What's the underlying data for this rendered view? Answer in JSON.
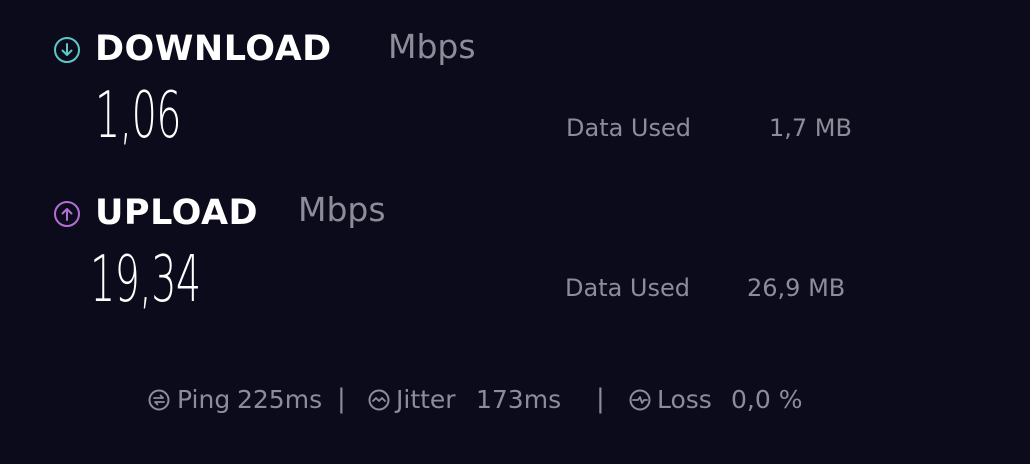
{
  "colors": {
    "background": "#0c0b1b",
    "download_accent": "#5ec8c8",
    "upload_accent": "#b36fd6",
    "muted": "#8d8c99",
    "text": "#ffffff"
  },
  "download": {
    "icon": "arrow-down-circle-icon",
    "title": "DOWNLOAD",
    "unit": "Mbps",
    "value": "1,06",
    "data_used_label": "Data Used",
    "data_used_value": "1,7 MB"
  },
  "upload": {
    "icon": "arrow-up-circle-icon",
    "title": "UPLOAD",
    "unit": "Mbps",
    "value": "19,34",
    "data_used_label": "Data Used",
    "data_used_value": "26,9 MB"
  },
  "stats": {
    "ping": {
      "icon": "ping-icon",
      "label": "Ping",
      "value": "225ms"
    },
    "jitter": {
      "icon": "jitter-icon",
      "label": "Jitter",
      "value": "173ms"
    },
    "loss": {
      "icon": "loss-icon",
      "label": "Loss",
      "value": "0,0 %"
    },
    "separator": "|"
  }
}
